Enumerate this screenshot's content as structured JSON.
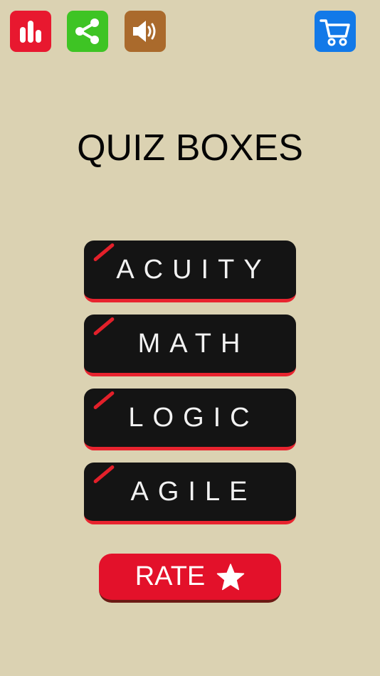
{
  "title": "QUIZ BOXES",
  "toolbar": {
    "stats_icon": "bar-chart-icon",
    "share_icon": "share-icon",
    "sound_icon": "speaker-icon",
    "cart_icon": "shopping-cart-icon"
  },
  "menu": {
    "items": [
      {
        "label": "ACUITY"
      },
      {
        "label": "MATH"
      },
      {
        "label": "LOGIC"
      },
      {
        "label": "AGILE"
      }
    ]
  },
  "rate": {
    "label": "RATE",
    "icon": "star-icon"
  },
  "colors": {
    "background": "#dbd2b2",
    "stats_red": "#e8182f",
    "share_green": "#3ec424",
    "sound_brown": "#aa6a2c",
    "cart_blue": "#1279e8",
    "button_black": "#141414",
    "accent_red": "#e3202a",
    "rate_red": "#e3112a"
  }
}
